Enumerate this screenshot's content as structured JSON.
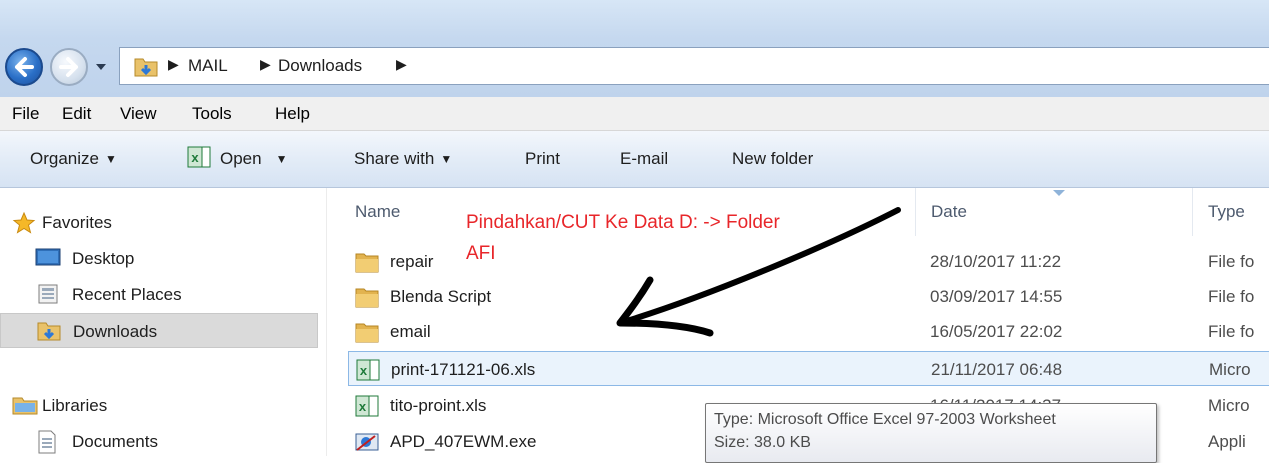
{
  "breadcrumb": [
    "MAIL",
    "Downloads"
  ],
  "menu": [
    "File",
    "Edit",
    "View",
    "Tools",
    "Help"
  ],
  "commands": {
    "organize": "Organize",
    "open": "Open",
    "share_with": "Share with",
    "print": "Print",
    "email": "E-mail",
    "new_folder": "New folder"
  },
  "nav": {
    "favorites": "Favorites",
    "desktop": "Desktop",
    "recent_places": "Recent Places",
    "downloads": "Downloads",
    "libraries": "Libraries",
    "documents": "Documents"
  },
  "columns": {
    "name": "Name",
    "date": "Date",
    "type": "Type"
  },
  "files": [
    {
      "name": "repair",
      "date": "28/10/2017 11:22",
      "type": "File fo",
      "icon": "folder-icon"
    },
    {
      "name": "Blenda Script",
      "date": "03/09/2017 14:55",
      "type": "File fo",
      "icon": "folder-icon"
    },
    {
      "name": "email",
      "date": "16/05/2017 22:02",
      "type": "File fo",
      "icon": "folder-icon"
    },
    {
      "name": "print-171121-06.xls",
      "date": "21/11/2017 06:48",
      "type": "Micro",
      "icon": "excel-icon"
    },
    {
      "name": "tito-proint.xls",
      "date": "16/11/2017 14:37",
      "type": "Micro",
      "icon": "excel-icon"
    },
    {
      "name": "APD_407EWM.exe",
      "date": "",
      "type": "Appli",
      "icon": "exe-icon"
    }
  ],
  "annotation": {
    "line1": "Pindahkan/CUT Ke Data D: -> Folder",
    "line2": "AFI",
    "color": "#e8262a"
  },
  "tooltip": {
    "type_line": "Type: Microsoft Office Excel 97-2003 Worksheet",
    "size_line": "Size: 38.0 KB"
  },
  "colors": {
    "selection": "#eaf3fc",
    "selection_border": "#8cb8e6",
    "toolbar": "#dfe9f5"
  }
}
